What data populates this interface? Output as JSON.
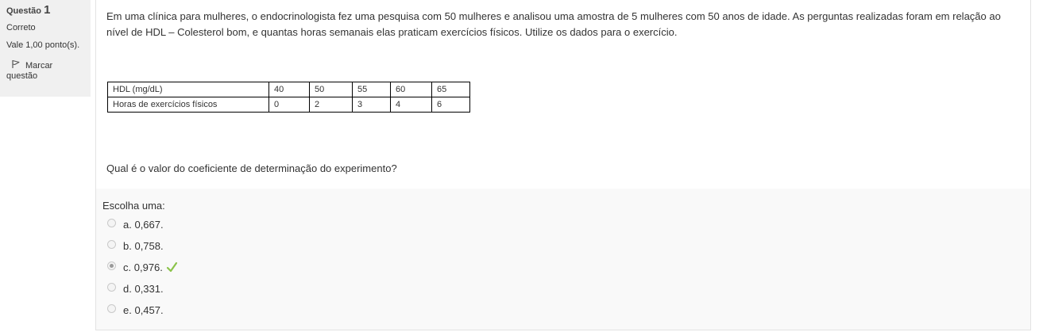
{
  "info": {
    "question_label": "Questão",
    "question_number": "1",
    "state": "Correto",
    "grade": "Vale 1,00 ponto(s).",
    "flag_label_line1": "Marcar",
    "flag_label_line2": "questão"
  },
  "question": {
    "text": "Em uma clínica para mulheres, o endocrinologista fez uma pesquisa com 50 mulheres e analisou uma amostra de 5 mulheres com 50 anos de idade. As perguntas realizadas foram em relação ao nível de HDL – Colesterol bom, e quantas horas semanais elas praticam exercícios físicos. Utilize os dados para o exercício.",
    "prompt": "Qual é o valor do coeficiente de determinação do experimento?",
    "table": {
      "rows": [
        {
          "label": "HDL (mg/dL)",
          "values": [
            "40",
            "50",
            "55",
            "60",
            "65"
          ]
        },
        {
          "label": "Horas de exercícios físicos",
          "values": [
            "0",
            "2",
            "3",
            "4",
            "6"
          ]
        }
      ]
    }
  },
  "answer": {
    "choose_label": "Escolha uma:",
    "options": [
      {
        "letter": "a.",
        "value": "0,667.",
        "selected": false
      },
      {
        "letter": "b.",
        "value": "0,758.",
        "selected": false
      },
      {
        "letter": "c.",
        "value": "0,976.",
        "selected": true,
        "correct": true
      },
      {
        "letter": "d.",
        "value": "0,331.",
        "selected": false
      },
      {
        "letter": "e.",
        "value": "0,457.",
        "selected": false
      }
    ]
  },
  "colors": {
    "info_background": "#f0f0f0",
    "content_background": "#f9f9f9",
    "correct_tick": "#8bc34a"
  },
  "icons": {
    "flag": "flag-icon",
    "correct": "check-icon"
  }
}
